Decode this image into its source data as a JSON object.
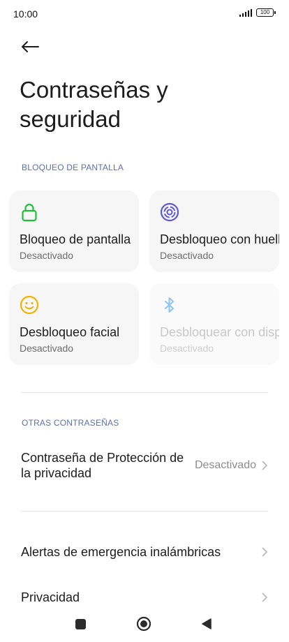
{
  "status_bar": {
    "time": "10:00",
    "battery": "100"
  },
  "header": {
    "title": "Contraseñas y seguridad"
  },
  "screen_lock_section": {
    "header": "BLOQUEO DE PANTALLA",
    "cards": [
      {
        "title": "Bloqueo de pantalla",
        "status": "Desactivado",
        "icon": "lock-icon",
        "color": "#1fbf3a",
        "enabled": true
      },
      {
        "title": "Desbloqueo con huella",
        "status": "Desactivado",
        "icon": "fingerprint-icon",
        "color": "#5c58d6",
        "enabled": true
      },
      {
        "title": "Desbloqueo facial",
        "status": "Desactivado",
        "icon": "face-icon",
        "color": "#f0b400",
        "enabled": true
      },
      {
        "title": "Desbloquear con dispositivo",
        "status": "Desactivado",
        "icon": "bluetooth-icon",
        "color": "#8fc3f0",
        "enabled": false
      }
    ]
  },
  "other_passwords_section": {
    "header": "OTRAS CONTRASEÑAS",
    "privacy_password": {
      "title": "Contraseña de Protección de la privacidad",
      "value": "Desactivado"
    }
  },
  "items": {
    "emergency_alerts": "Alertas de emergencia inalámbricas",
    "privacy": "Privacidad"
  }
}
